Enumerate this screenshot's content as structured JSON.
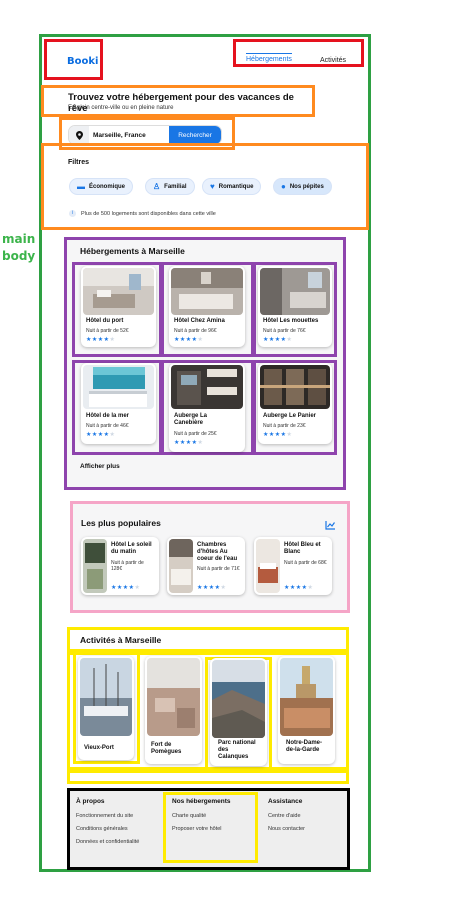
{
  "side_label": "main body",
  "header": {
    "logo": "Booki",
    "nav": [
      "Hébergements",
      "Activités"
    ]
  },
  "hero": {
    "title": "Trouvez votre hébergement pour des vacances de rêve",
    "subtitle": "En plein centre-ville ou en pleine nature",
    "search_value": "Marseille, France",
    "search_button": "Rechercher"
  },
  "filters": {
    "title": "Filtres",
    "items": [
      "Économique",
      "Familial",
      "Romantique",
      "Nos pépites"
    ],
    "info": "Plus de 500 logements sont disponibles dans cette ville"
  },
  "accommodations": {
    "title": "Hébergements à Marseille",
    "items": [
      {
        "name": "Hôtel du port",
        "price": "Nuit à partir de 52€",
        "stars": 4
      },
      {
        "name": "Hôtel Chez Amina",
        "price": "Nuit à partir de 96€",
        "stars": 4
      },
      {
        "name": "Hôtel Les mouettes",
        "price": "Nuit à partir de 76€",
        "stars": 4
      },
      {
        "name": "Hôtel de la mer",
        "price": "Nuit à partir de 46€",
        "stars": 4
      },
      {
        "name": "Auberge La Canebière",
        "price": "Nuit à partir de 25€",
        "stars": 4
      },
      {
        "name": "Auberge Le Panier",
        "price": "Nuit à partir de 23€",
        "stars": 4
      }
    ],
    "show_more": "Afficher plus"
  },
  "popular": {
    "title": "Les plus populaires",
    "items": [
      {
        "name": "Hôtel Le soleil du matin",
        "price": "Nuit à partir de 128€",
        "stars": 4
      },
      {
        "name": "Chambres d'hôtes Au coeur de l'eau",
        "price": "Nuit à partir de 71€",
        "stars": 4
      },
      {
        "name": "Hôtel Bleu et Blanc",
        "price": "Nuit à partir de 68€",
        "stars": 4
      }
    ]
  },
  "activities": {
    "title": "Activités à Marseille",
    "items": [
      "Vieux-Port",
      "Fort de Pomègues",
      "Parc national des Calanques",
      "Notre-Dame-de-la-Garde"
    ]
  },
  "footer": {
    "cols": [
      {
        "title": "À propos",
        "links": [
          "Fonctionnement du site",
          "Conditions générales",
          "Données et confidentialité"
        ]
      },
      {
        "title": "Nos hébergements",
        "links": [
          "Charte qualité",
          "Proposer votre hôtel"
        ]
      },
      {
        "title": "Assistance",
        "links": [
          "Centre d'aide",
          "Nous contacter"
        ]
      }
    ]
  },
  "colors": {
    "accent": "#1976e5",
    "star_on": "#1976e5",
    "star_off": "#cfd8e3"
  }
}
